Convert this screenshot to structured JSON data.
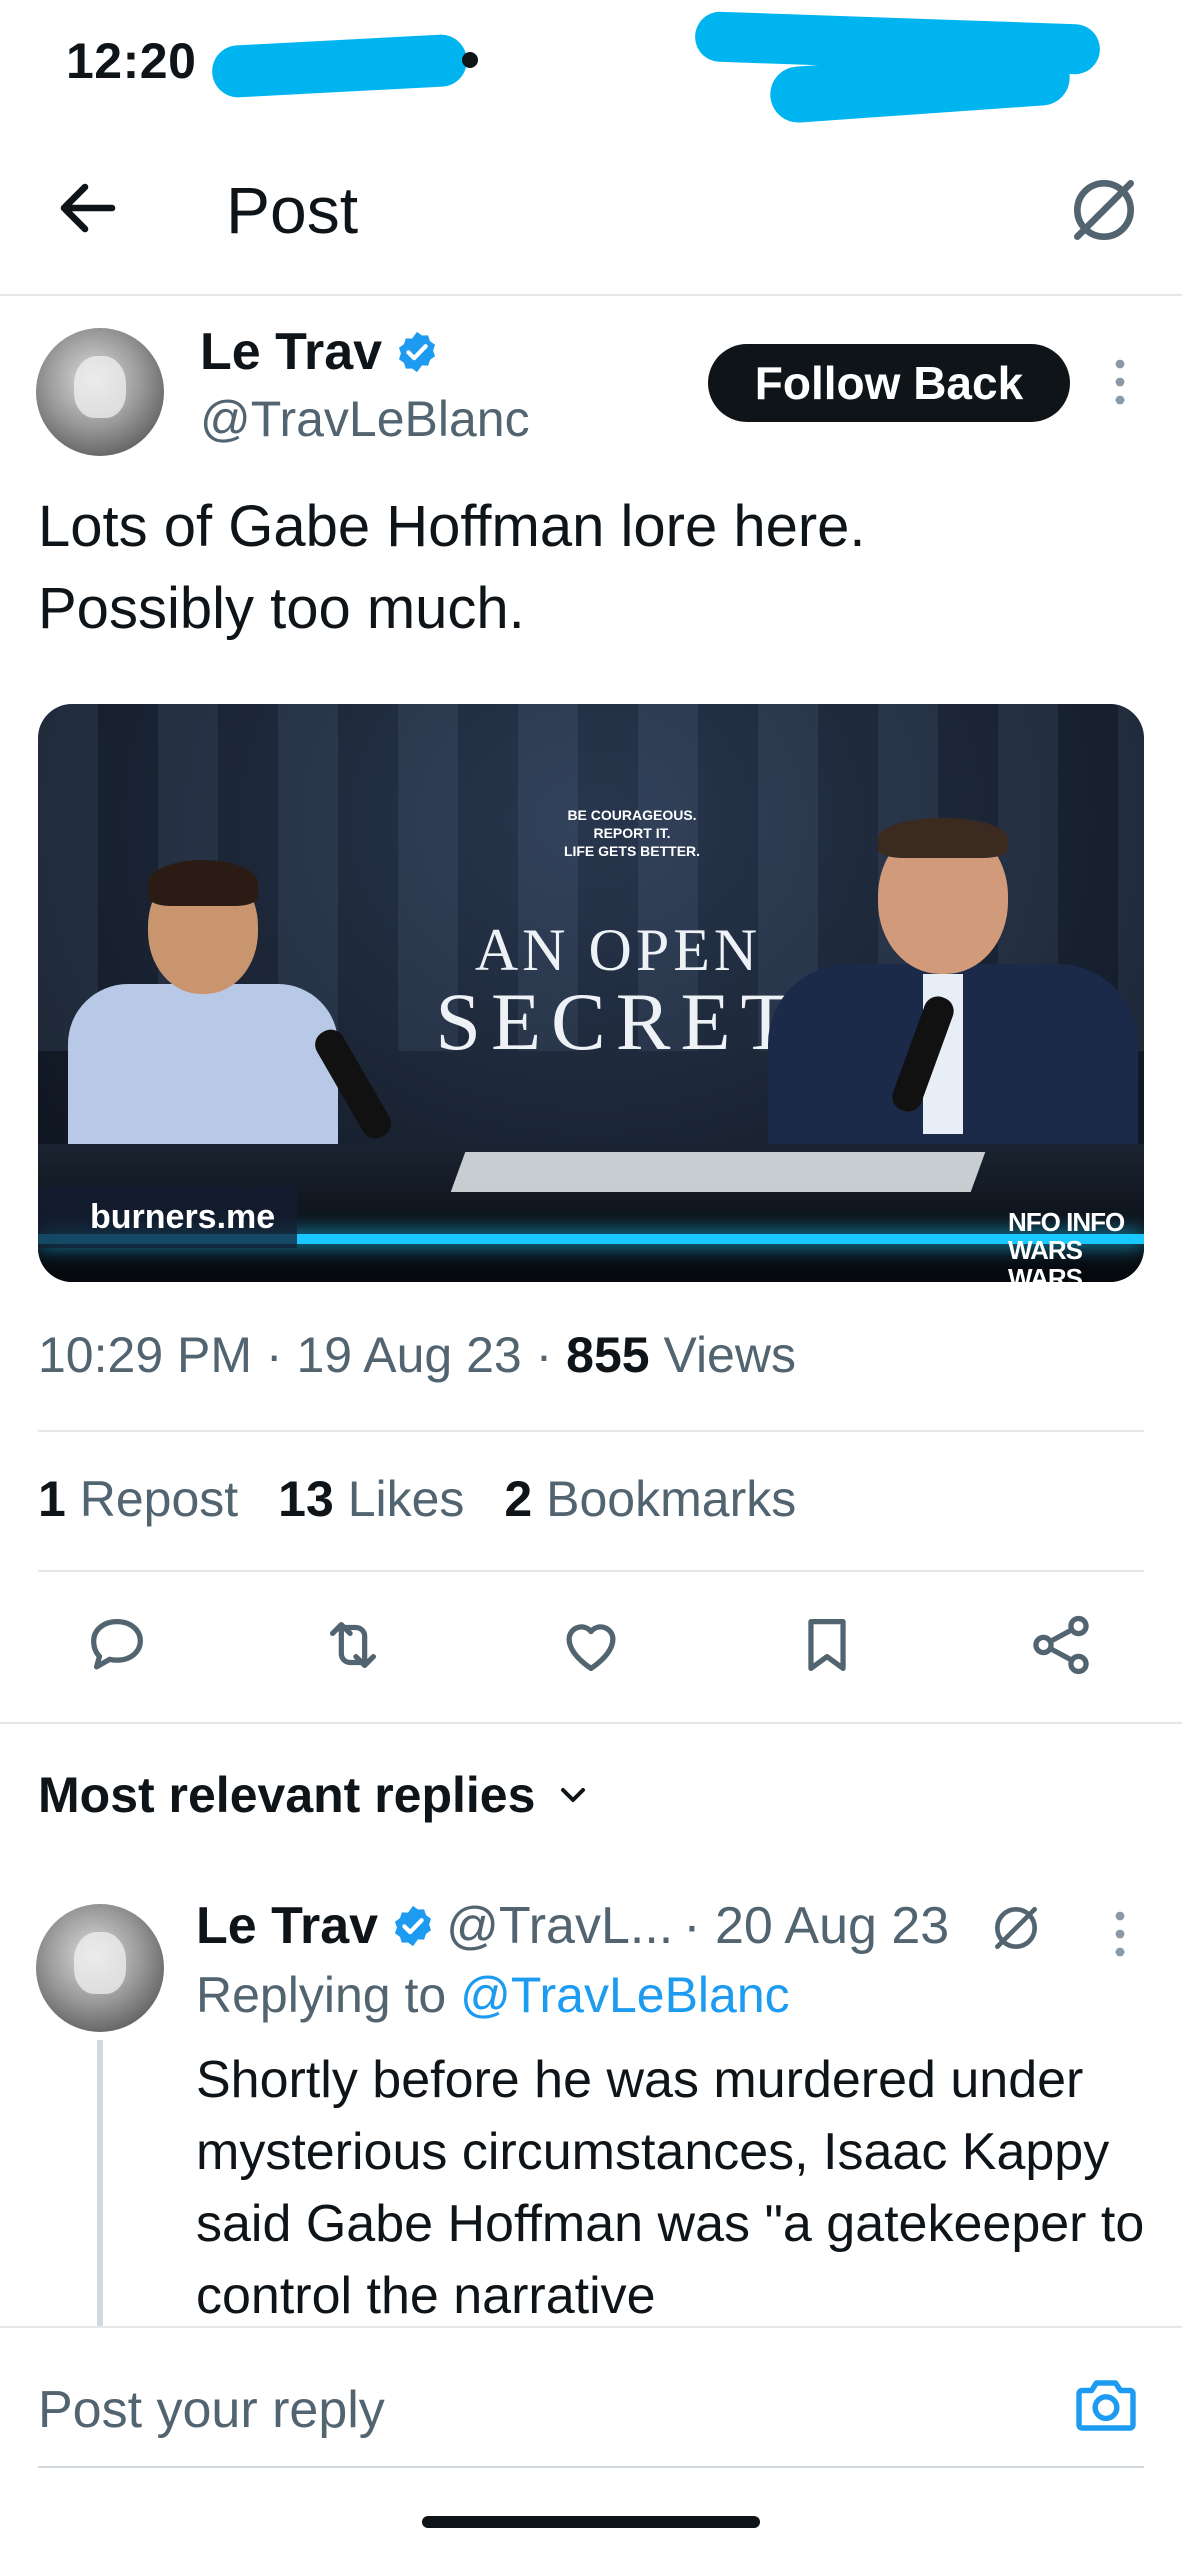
{
  "status_bar": {
    "time": "12:20"
  },
  "header": {
    "title": "Post"
  },
  "post": {
    "author_name": "Le Trav",
    "author_handle": "@TravLeBlanc",
    "follow_label": "Follow Back",
    "text_line1": "Lots of Gabe Hoffman lore here.",
    "text_line2": "Possibly too much.",
    "media": {
      "sign_small_1": "Be courageous.",
      "sign_small_2": "Report it.",
      "sign_small_3": "Life gets better.",
      "sign_line1": "AN OPEN",
      "sign_line2": "SECRET",
      "watermark": "burners.me",
      "brand_1": "NFO INFO",
      "brand_2": "WARS WARS"
    },
    "time": "10:29 PM",
    "date": "19 Aug 23",
    "views_count": "855",
    "views_label": "Views",
    "reposts_count": "1",
    "reposts_label": "Repost",
    "likes_count": "13",
    "likes_label": "Likes",
    "bookmarks_count": "2",
    "bookmarks_label": "Bookmarks"
  },
  "icons": {
    "back": "arrow-left-icon",
    "grok": "grok-icon",
    "verified": "verified-badge-icon",
    "more": "more-vertical-icon",
    "reply": "reply-icon",
    "repost": "repost-icon",
    "like": "heart-icon",
    "bookmark": "bookmark-icon",
    "share": "share-icon",
    "camera": "camera-icon",
    "chevron": "chevron-down-icon"
  },
  "colors": {
    "accent": "#1d9bf0",
    "text": "#0f1419",
    "muted": "#536471",
    "redaction": "#00b4f0"
  },
  "replies": {
    "sort_label": "Most relevant replies",
    "items": [
      {
        "name": "Le Trav",
        "handle": "@TravL...",
        "date": "· 20 Aug 23",
        "replying_prefix": "Replying to",
        "replying_to": "@TravLeBlanc",
        "text": "Shortly before he was murdered under mysterious circumstances, Isaac Kappy said Gabe Hoffman was \"a gatekeeper to control the narrative"
      }
    ]
  },
  "composer": {
    "placeholder": "Post your reply"
  }
}
